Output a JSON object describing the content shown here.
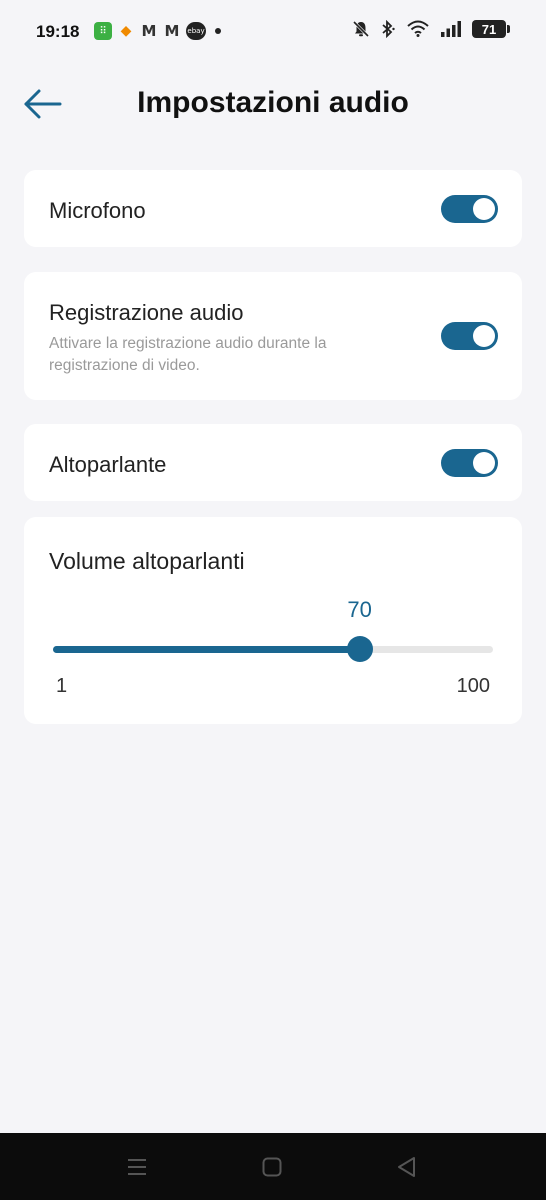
{
  "status_bar": {
    "time": "19:18",
    "battery": "71",
    "notification_icons": [
      "grid-app-icon",
      "orange-app-icon",
      "gmail-icon",
      "gmail-icon",
      "ebay-icon",
      "dot-icon"
    ],
    "system_icons": [
      "muted-bell-icon",
      "bluetooth-icon",
      "wifi-icon",
      "signal-icon",
      "battery-icon"
    ]
  },
  "header": {
    "title": "Impostazioni audio",
    "back_icon": "arrow-left-icon"
  },
  "settings": {
    "microphone": {
      "label": "Microfono",
      "enabled": true
    },
    "recording": {
      "label": "Registrazione audio",
      "description": "Attivare la registrazione audio durante la registrazione di video.",
      "enabled": true
    },
    "speaker": {
      "label": "Altoparlante",
      "enabled": true
    },
    "volume": {
      "label": "Volume altoparlanti",
      "value": "70",
      "min": "1",
      "max": "100"
    }
  },
  "nav_bar": {
    "icons": [
      "menu-icon",
      "home-icon",
      "back-icon"
    ]
  },
  "colors": {
    "accent": "#1a6690",
    "background": "#f5f5f8",
    "card": "#ffffff",
    "secondary_text": "#9a9a9a",
    "nav_background": "#0c0c0c"
  }
}
